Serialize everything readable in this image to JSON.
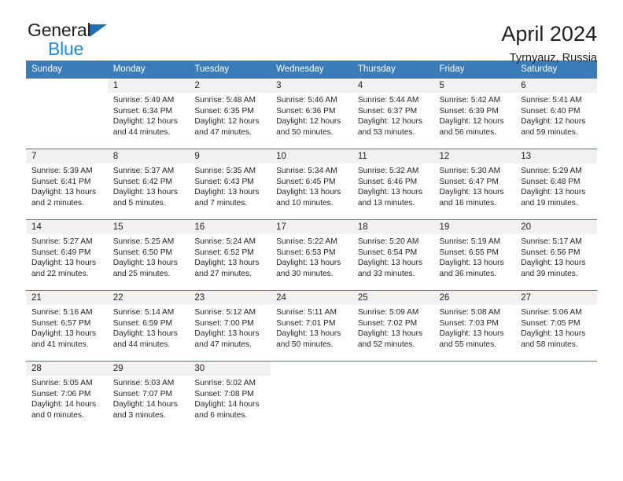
{
  "brand": {
    "name_part1": "General",
    "name_part2": "Blue",
    "logo_icon": "triangle-flag-icon"
  },
  "header": {
    "title": "April 2024",
    "subtitle": "Tyrnyauz, Russia"
  },
  "colors": {
    "header_blue": "#3a7cb8",
    "brand_blue": "#1c8ce0",
    "logo_blue": "#1c6fb5",
    "daynum_bg": "#f1f1f1",
    "text": "#231f20"
  },
  "weekday_headers": [
    "Sunday",
    "Monday",
    "Tuesday",
    "Wednesday",
    "Thursday",
    "Friday",
    "Saturday"
  ],
  "labels": {
    "sunrise_prefix": "Sunrise:",
    "sunset_prefix": "Sunset:",
    "daylight_prefix": "Daylight:"
  },
  "weeks": [
    [
      {
        "empty": true
      },
      {
        "day": "1",
        "sunrise": "Sunrise: 5:49 AM",
        "sunset": "Sunset: 6:34 PM",
        "daylight1": "Daylight: 12 hours",
        "daylight2": "and 44 minutes."
      },
      {
        "day": "2",
        "sunrise": "Sunrise: 5:48 AM",
        "sunset": "Sunset: 6:35 PM",
        "daylight1": "Daylight: 12 hours",
        "daylight2": "and 47 minutes."
      },
      {
        "day": "3",
        "sunrise": "Sunrise: 5:46 AM",
        "sunset": "Sunset: 6:36 PM",
        "daylight1": "Daylight: 12 hours",
        "daylight2": "and 50 minutes."
      },
      {
        "day": "4",
        "sunrise": "Sunrise: 5:44 AM",
        "sunset": "Sunset: 6:37 PM",
        "daylight1": "Daylight: 12 hours",
        "daylight2": "and 53 minutes."
      },
      {
        "day": "5",
        "sunrise": "Sunrise: 5:42 AM",
        "sunset": "Sunset: 6:39 PM",
        "daylight1": "Daylight: 12 hours",
        "daylight2": "and 56 minutes."
      },
      {
        "day": "6",
        "sunrise": "Sunrise: 5:41 AM",
        "sunset": "Sunset: 6:40 PM",
        "daylight1": "Daylight: 12 hours",
        "daylight2": "and 59 minutes."
      }
    ],
    [
      {
        "day": "7",
        "sunrise": "Sunrise: 5:39 AM",
        "sunset": "Sunset: 6:41 PM",
        "daylight1": "Daylight: 13 hours",
        "daylight2": "and 2 minutes."
      },
      {
        "day": "8",
        "sunrise": "Sunrise: 5:37 AM",
        "sunset": "Sunset: 6:42 PM",
        "daylight1": "Daylight: 13 hours",
        "daylight2": "and 5 minutes."
      },
      {
        "day": "9",
        "sunrise": "Sunrise: 5:35 AM",
        "sunset": "Sunset: 6:43 PM",
        "daylight1": "Daylight: 13 hours",
        "daylight2": "and 7 minutes."
      },
      {
        "day": "10",
        "sunrise": "Sunrise: 5:34 AM",
        "sunset": "Sunset: 6:45 PM",
        "daylight1": "Daylight: 13 hours",
        "daylight2": "and 10 minutes."
      },
      {
        "day": "11",
        "sunrise": "Sunrise: 5:32 AM",
        "sunset": "Sunset: 6:46 PM",
        "daylight1": "Daylight: 13 hours",
        "daylight2": "and 13 minutes."
      },
      {
        "day": "12",
        "sunrise": "Sunrise: 5:30 AM",
        "sunset": "Sunset: 6:47 PM",
        "daylight1": "Daylight: 13 hours",
        "daylight2": "and 16 minutes."
      },
      {
        "day": "13",
        "sunrise": "Sunrise: 5:29 AM",
        "sunset": "Sunset: 6:48 PM",
        "daylight1": "Daylight: 13 hours",
        "daylight2": "and 19 minutes."
      }
    ],
    [
      {
        "day": "14",
        "sunrise": "Sunrise: 5:27 AM",
        "sunset": "Sunset: 6:49 PM",
        "daylight1": "Daylight: 13 hours",
        "daylight2": "and 22 minutes."
      },
      {
        "day": "15",
        "sunrise": "Sunrise: 5:25 AM",
        "sunset": "Sunset: 6:50 PM",
        "daylight1": "Daylight: 13 hours",
        "daylight2": "and 25 minutes."
      },
      {
        "day": "16",
        "sunrise": "Sunrise: 5:24 AM",
        "sunset": "Sunset: 6:52 PM",
        "daylight1": "Daylight: 13 hours",
        "daylight2": "and 27 minutes."
      },
      {
        "day": "17",
        "sunrise": "Sunrise: 5:22 AM",
        "sunset": "Sunset: 6:53 PM",
        "daylight1": "Daylight: 13 hours",
        "daylight2": "and 30 minutes."
      },
      {
        "day": "18",
        "sunrise": "Sunrise: 5:20 AM",
        "sunset": "Sunset: 6:54 PM",
        "daylight1": "Daylight: 13 hours",
        "daylight2": "and 33 minutes."
      },
      {
        "day": "19",
        "sunrise": "Sunrise: 5:19 AM",
        "sunset": "Sunset: 6:55 PM",
        "daylight1": "Daylight: 13 hours",
        "daylight2": "and 36 minutes."
      },
      {
        "day": "20",
        "sunrise": "Sunrise: 5:17 AM",
        "sunset": "Sunset: 6:56 PM",
        "daylight1": "Daylight: 13 hours",
        "daylight2": "and 39 minutes."
      }
    ],
    [
      {
        "day": "21",
        "sunrise": "Sunrise: 5:16 AM",
        "sunset": "Sunset: 6:57 PM",
        "daylight1": "Daylight: 13 hours",
        "daylight2": "and 41 minutes."
      },
      {
        "day": "22",
        "sunrise": "Sunrise: 5:14 AM",
        "sunset": "Sunset: 6:59 PM",
        "daylight1": "Daylight: 13 hours",
        "daylight2": "and 44 minutes."
      },
      {
        "day": "23",
        "sunrise": "Sunrise: 5:12 AM",
        "sunset": "Sunset: 7:00 PM",
        "daylight1": "Daylight: 13 hours",
        "daylight2": "and 47 minutes."
      },
      {
        "day": "24",
        "sunrise": "Sunrise: 5:11 AM",
        "sunset": "Sunset: 7:01 PM",
        "daylight1": "Daylight: 13 hours",
        "daylight2": "and 50 minutes."
      },
      {
        "day": "25",
        "sunrise": "Sunrise: 5:09 AM",
        "sunset": "Sunset: 7:02 PM",
        "daylight1": "Daylight: 13 hours",
        "daylight2": "and 52 minutes."
      },
      {
        "day": "26",
        "sunrise": "Sunrise: 5:08 AM",
        "sunset": "Sunset: 7:03 PM",
        "daylight1": "Daylight: 13 hours",
        "daylight2": "and 55 minutes."
      },
      {
        "day": "27",
        "sunrise": "Sunrise: 5:06 AM",
        "sunset": "Sunset: 7:05 PM",
        "daylight1": "Daylight: 13 hours",
        "daylight2": "and 58 minutes."
      }
    ],
    [
      {
        "day": "28",
        "sunrise": "Sunrise: 5:05 AM",
        "sunset": "Sunset: 7:06 PM",
        "daylight1": "Daylight: 14 hours",
        "daylight2": "and 0 minutes."
      },
      {
        "day": "29",
        "sunrise": "Sunrise: 5:03 AM",
        "sunset": "Sunset: 7:07 PM",
        "daylight1": "Daylight: 14 hours",
        "daylight2": "and 3 minutes."
      },
      {
        "day": "30",
        "sunrise": "Sunrise: 5:02 AM",
        "sunset": "Sunset: 7:08 PM",
        "daylight1": "Daylight: 14 hours",
        "daylight2": "and 6 minutes."
      },
      {
        "empty": true
      },
      {
        "empty": true
      },
      {
        "empty": true
      },
      {
        "empty": true
      }
    ]
  ]
}
